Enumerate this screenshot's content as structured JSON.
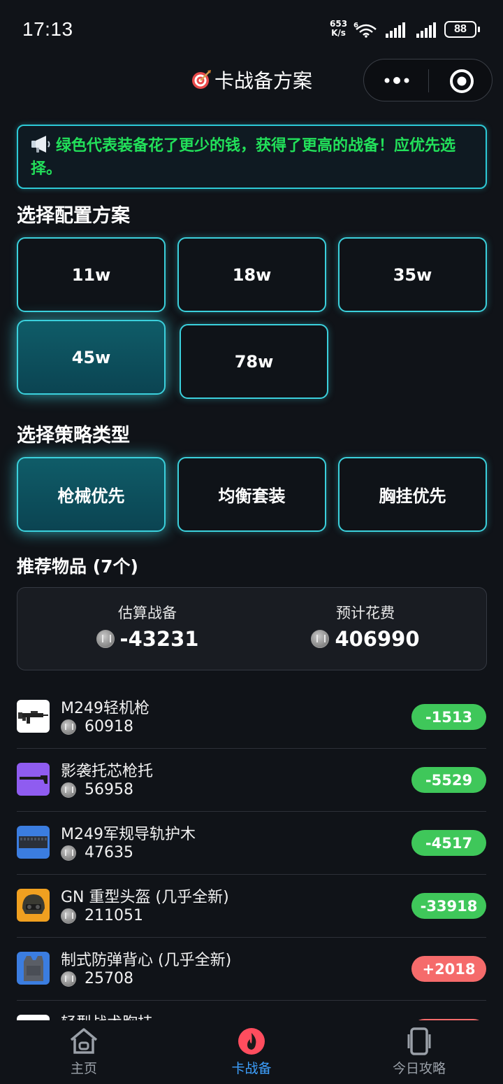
{
  "status_bar": {
    "time": "17:13",
    "net_speed_value": "653",
    "net_speed_unit": "K/s",
    "network_type": "6",
    "battery": "88"
  },
  "nav": {
    "title": "卡战备方案",
    "title_icon": "target-dart-icon"
  },
  "notice": {
    "icon": "megaphone-icon",
    "text": "绿色代表装备花了更少的钱，获得了更高的战备！应优先选择。",
    "color": "#22e05a"
  },
  "config_section": {
    "title": "选择配置方案",
    "options": [
      {
        "label": "11w",
        "selected": false
      },
      {
        "label": "18w",
        "selected": false
      },
      {
        "label": "35w",
        "selected": false
      },
      {
        "label": "45w",
        "selected": true
      },
      {
        "label": "78w",
        "selected": false
      }
    ]
  },
  "strategy_section": {
    "title": "选择策略类型",
    "options": [
      {
        "label": "枪械优先",
        "selected": true
      },
      {
        "label": "均衡套装",
        "selected": false
      },
      {
        "label": "胸挂优先",
        "selected": false
      }
    ]
  },
  "recommend": {
    "title": "推荐物品 (7个)",
    "summary": {
      "readiness_label": "估算战备",
      "readiness_value": "-43231",
      "cost_label": "预计花费",
      "cost_value": "406990"
    },
    "items": [
      {
        "name": "M249轻机枪",
        "price": "60918",
        "delta": "-1513",
        "delta_type": "negative",
        "thumb_bg": "#ffffff",
        "thumb_icon": "machine-gun-icon"
      },
      {
        "name": "影袭托芯枪托",
        "price": "56958",
        "delta": "-5529",
        "delta_type": "negative",
        "thumb_bg": "#8f5cf0",
        "thumb_icon": "gun-stock-icon"
      },
      {
        "name": "M249军规导轨护木",
        "price": "47635",
        "delta": "-4517",
        "delta_type": "negative",
        "thumb_bg": "#3b7de0",
        "thumb_icon": "rail-handguard-icon"
      },
      {
        "name": "GN 重型头盔 (几乎全新)",
        "price": "211051",
        "delta": "-33918",
        "delta_type": "negative",
        "thumb_bg": "#f0a020",
        "thumb_icon": "helmet-icon"
      },
      {
        "name": "制式防弹背心 (几乎全新)",
        "price": "25708",
        "delta": "+2018",
        "delta_type": "positive",
        "thumb_bg": "#3b7de0",
        "thumb_icon": "vest-icon"
      },
      {
        "name": "轻型战术胸挂",
        "price": "",
        "delta": "",
        "delta_type": "positive",
        "thumb_bg": "#ffffff",
        "thumb_icon": "chest-rig-icon"
      }
    ]
  },
  "tabbar": {
    "tabs": [
      {
        "label": "主页",
        "icon": "home-icon",
        "active": false
      },
      {
        "label": "卡战备",
        "icon": "flame-icon",
        "active": true
      },
      {
        "label": "今日攻略",
        "icon": "phone-guide-icon",
        "active": false
      }
    ],
    "active_color": "#3ea1ff"
  },
  "colors": {
    "background": "#101318",
    "accent_cyan": "#3bd0dc",
    "negative_delta": "#3fc75a",
    "positive_delta": "#f56b6b"
  }
}
